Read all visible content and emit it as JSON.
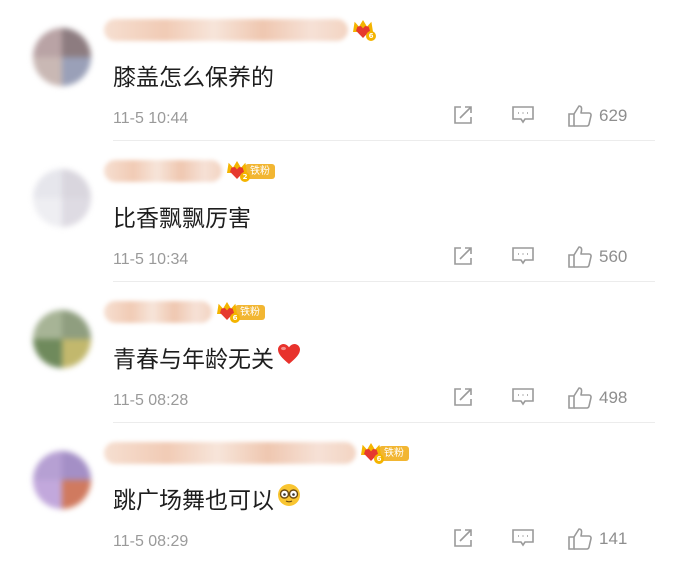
{
  "fan_badge_label": "铁粉",
  "comments": [
    {
      "text": "膝盖怎么保养的",
      "emoji": "",
      "time": "11-5 10:44",
      "likes": "629",
      "crown_level": "6",
      "has_fan_badge": false
    },
    {
      "text": "比香飘飘厉害",
      "emoji": "",
      "time": "11-5 10:34",
      "likes": "560",
      "crown_level": "2",
      "has_fan_badge": true
    },
    {
      "text": "青春与年龄无关",
      "emoji": "heart",
      "time": "11-5 08:28",
      "likes": "498",
      "crown_level": "6",
      "has_fan_badge": true
    },
    {
      "text": "跳广场舞也可以",
      "emoji": "glasses-face",
      "time": "11-5 08:29",
      "likes": "141",
      "crown_level": "6",
      "has_fan_badge": true
    }
  ],
  "colors": {
    "text": "#1e1e1e",
    "meta": "#9a9a9a",
    "badge": "#f2b632",
    "crown": "#f4b400",
    "heart": "#e6392f"
  }
}
